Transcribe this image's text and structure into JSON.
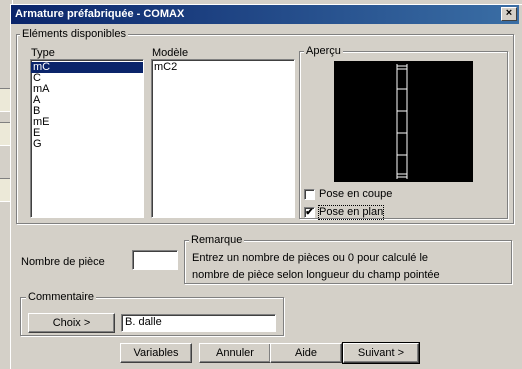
{
  "window": {
    "title": "Armature préfabriquée - COMAX",
    "close_glyph": "×"
  },
  "elements": {
    "group_label": "Eléments disponibles",
    "type_label": "Type",
    "model_label": "Modèle",
    "preview_label": "Aperçu",
    "types": [
      "mC",
      "C",
      "mA",
      "A",
      "B",
      "mE",
      "E",
      "G"
    ],
    "selected_type": "mC",
    "models": [
      "mC2"
    ],
    "pose_coupe": {
      "label": "Pose en coupe",
      "checked": false
    },
    "pose_plan": {
      "label": "Pose en plan",
      "checked": true,
      "check_glyph": "✔"
    }
  },
  "piece": {
    "label": "Nombre de pièce",
    "value": ""
  },
  "remarque": {
    "label": "Remarque",
    "line1": "Entrez un nombre de pièces ou 0 pour calculé le",
    "line2": "nombre de pièce selon longueur du champ pointée"
  },
  "commentaire": {
    "label": "Commentaire",
    "choix_button": "Choix >",
    "value": "B. dalle"
  },
  "buttons": {
    "variables": "Variables",
    "annuler": "Annuler",
    "aide": "Aide",
    "suivant": "Suivant >"
  },
  "colors": {
    "titlebar_start": "#0a246a",
    "titlebar_end": "#3a6ea5",
    "face": "#d4d0c8",
    "selection": "#0a246a"
  }
}
